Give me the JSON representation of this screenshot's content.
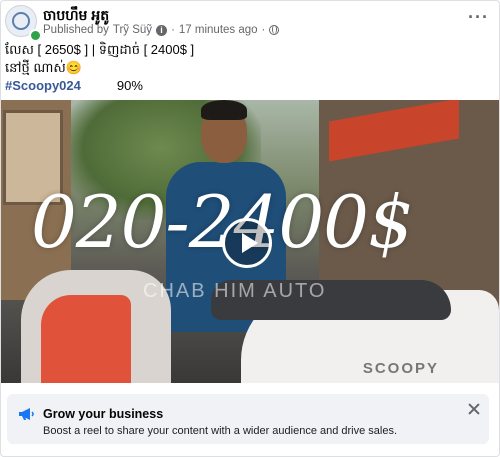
{
  "post": {
    "page_name": "ចាបហឹម អូតូ",
    "meta_published_by": "Published by",
    "meta_author": "Trỹ Süỹ",
    "meta_time": "17 minutes ago",
    "meta_separator": "·",
    "text_line1": "លែស​  [ 2650$ ]    |  ទិញដាច់    [ 2400$ ]",
    "text_line2": "នៅថ្មី ណាស់😊",
    "hashtag": "#Scoopy024",
    "condition": "90%"
  },
  "video": {
    "overlay_price": "020-2400$",
    "watermark": "CHAB HIM AUTO",
    "scooter_brand": "SCOOPY"
  },
  "grow_banner": {
    "title": "Grow your business",
    "description": "Boost a reel to share your content with a wider audience and drive sales."
  },
  "icons": {
    "more": "more-horizontal-icon",
    "info": "info-icon",
    "globe": "globe-icon",
    "play": "play-icon",
    "megaphone": "megaphone-icon",
    "close": "close-icon"
  },
  "colors": {
    "hashtag": "#385898",
    "online": "#31a24c",
    "megaphone": "#1877f2",
    "banner_bg": "#f0f2f5"
  }
}
